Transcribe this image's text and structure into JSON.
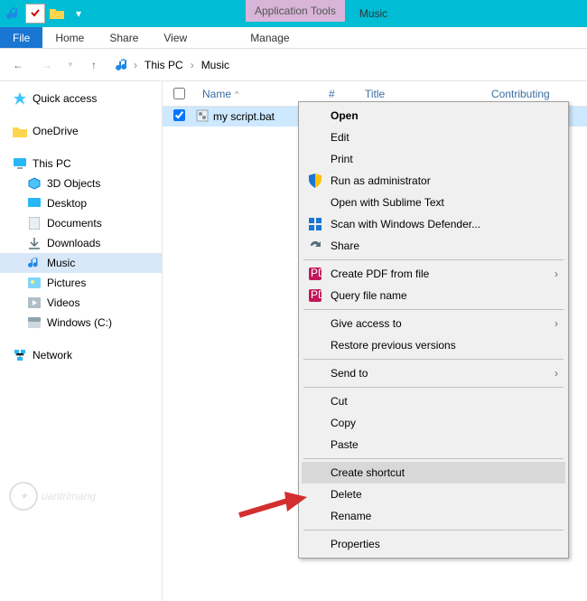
{
  "titlebar": {
    "tools_tab": "Application Tools",
    "window_title": "Music"
  },
  "ribbon": {
    "file": "File",
    "home": "Home",
    "share": "Share",
    "view": "View",
    "manage": "Manage"
  },
  "breadcrumb": {
    "this_pc": "This PC",
    "music": "Music"
  },
  "sidebar": {
    "quick_access": "Quick access",
    "onedrive": "OneDrive",
    "this_pc": "This PC",
    "objects_3d": "3D Objects",
    "desktop": "Desktop",
    "documents": "Documents",
    "downloads": "Downloads",
    "music": "Music",
    "pictures": "Pictures",
    "videos": "Videos",
    "windows_c": "Windows (C:)",
    "network": "Network"
  },
  "columns": {
    "name": "Name",
    "num": "#",
    "title": "Title",
    "contributing": "Contributing"
  },
  "files": {
    "item1": "my script.bat"
  },
  "context_menu": {
    "open": "Open",
    "edit": "Edit",
    "print": "Print",
    "run_admin": "Run as administrator",
    "open_sublime": "Open with Sublime Text",
    "scan_defender": "Scan with Windows Defender...",
    "share": "Share",
    "create_pdf": "Create PDF from file",
    "query_file": "Query file name",
    "give_access": "Give access to",
    "restore_prev": "Restore previous versions",
    "send_to": "Send to",
    "cut": "Cut",
    "copy": "Copy",
    "paste": "Paste",
    "create_shortcut": "Create shortcut",
    "delete": "Delete",
    "rename": "Rename",
    "properties": "Properties"
  },
  "watermark": "uantrimang"
}
